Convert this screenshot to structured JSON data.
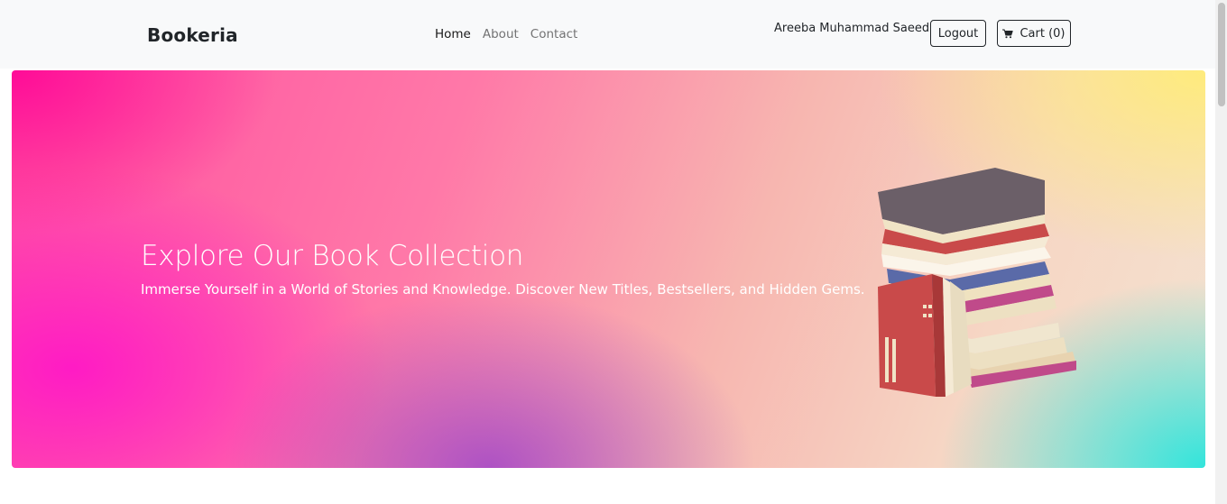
{
  "navbar": {
    "brand": "Bookeria",
    "links": [
      {
        "label": "Home",
        "active": true
      },
      {
        "label": "About",
        "active": false
      },
      {
        "label": "Contact",
        "active": false
      }
    ],
    "user_name": "Areeba Muhammad Saeed",
    "logout_label": "Logout",
    "cart_label": "Cart (0)",
    "cart_icon": "shopping-cart-icon"
  },
  "hero": {
    "title": "Explore Our Book Collection",
    "subtitle": "Immerse Yourself in a World of Stories and Knowledge. Discover New Titles, Bestsellers, and Hidden Gems.",
    "illustration": "stacked-books-illustration",
    "colors": {
      "pink": "#ff1fa8",
      "yellow": "#ffec78",
      "cyan": "#28e4dc",
      "purple": "#a046c8"
    }
  }
}
